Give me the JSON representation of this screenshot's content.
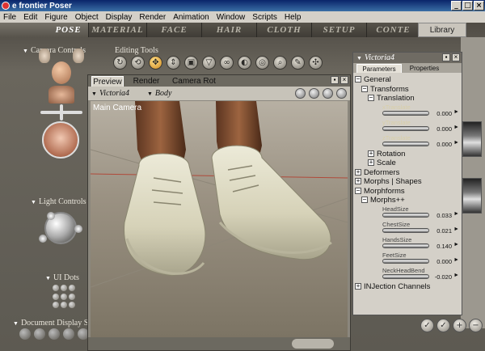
{
  "window": {
    "title": "e frontier Poser"
  },
  "menu": [
    "File",
    "Edit",
    "Figure",
    "Object",
    "Display",
    "Render",
    "Animation",
    "Window",
    "Scripts",
    "Help"
  ],
  "rooms": [
    "POSE",
    "MATERIAL",
    "FACE",
    "HAIR",
    "CLOTH",
    "SETUP",
    "CONTE"
  ],
  "library_tab": "Library",
  "left": {
    "camera_controls": "Camera Controls",
    "light_controls": "Light Controls",
    "ui_dots": "UI Dots",
    "document_display": "Document Display St"
  },
  "editing_tools": {
    "label": "Editing Tools"
  },
  "document": {
    "tabs": [
      "Preview",
      "Render",
      "Camera Rot"
    ],
    "figure_select": "Victoria4",
    "actor_select": "Body",
    "camera_name": "Main Camera"
  },
  "params": {
    "figure": "Victoria4",
    "tabs": [
      "Parameters",
      "Properties"
    ],
    "tree": [
      {
        "text": "General",
        "box": "−",
        "indent": 0
      },
      {
        "text": "Transforms",
        "box": "−",
        "indent": 1
      },
      {
        "text": "Translation",
        "box": "−",
        "indent": 2
      }
    ],
    "translation_sliders": [
      {
        "label": "xTranslate",
        "value": "0.000"
      },
      {
        "label": "yTranslate",
        "value": "0.000"
      },
      {
        "label": "zTranslate",
        "value": "0.000"
      }
    ],
    "tree2": [
      {
        "text": "Rotation",
        "box": "+",
        "indent": 2
      },
      {
        "text": "Scale",
        "box": "+",
        "indent": 2
      },
      {
        "text": "Deformers",
        "box": "+",
        "indent": 0
      },
      {
        "text": "Morphs | Shapes",
        "box": "+",
        "indent": 0
      },
      {
        "text": "Morphforms",
        "box": "−",
        "indent": 0
      },
      {
        "text": "Morphs++",
        "box": "−",
        "indent": 1
      }
    ],
    "morph_sliders": [
      {
        "label": "HeadSize",
        "value": "0.033"
      },
      {
        "label": "ChestSize",
        "value": "0.021"
      },
      {
        "label": "HandsSize",
        "value": "0.140"
      },
      {
        "label": "FeetSize",
        "value": "0.000"
      },
      {
        "label": "NeckHeadBend",
        "value": "-0.020"
      }
    ],
    "tree3": [
      {
        "text": "INJection Channels",
        "box": "+",
        "indent": 0
      }
    ]
  }
}
